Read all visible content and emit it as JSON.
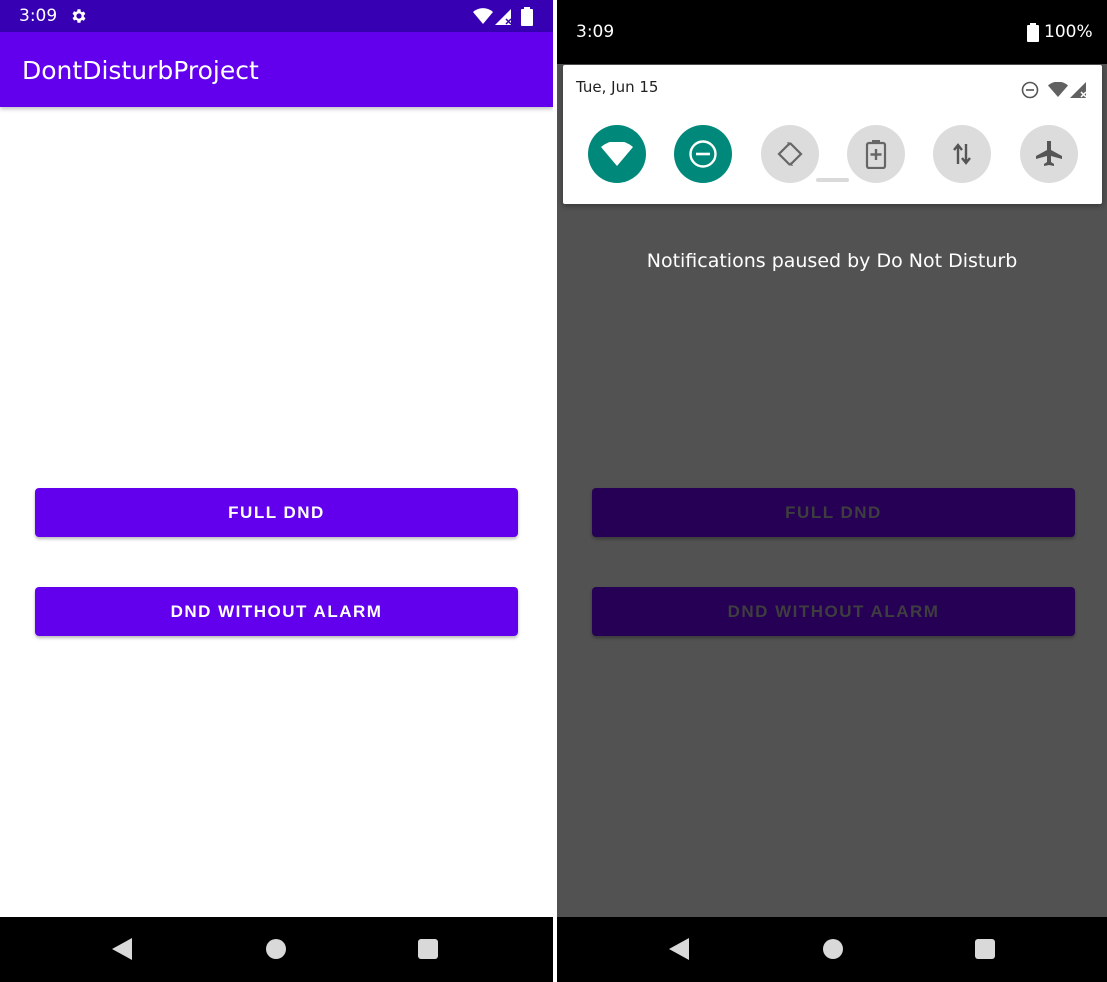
{
  "left": {
    "status_bar": {
      "time": "3:09"
    },
    "app_bar": {
      "title": "DontDisturbProject"
    },
    "buttons": {
      "full_dnd": "FULL DND",
      "dnd_without_alarm": "DND WITHOUT ALARM"
    }
  },
  "right": {
    "status_bar": {
      "time": "3:09",
      "battery_percent": "100%"
    },
    "quick_settings": {
      "date": "Tue, Jun 15",
      "tiles": [
        {
          "icon": "wifi-icon",
          "active": true
        },
        {
          "icon": "dnd-icon",
          "active": true
        },
        {
          "icon": "auto-rotate-icon",
          "active": false
        },
        {
          "icon": "battery-saver-icon",
          "active": false
        },
        {
          "icon": "mobile-data-icon",
          "active": false
        },
        {
          "icon": "airplane-mode-icon",
          "active": false
        }
      ]
    },
    "dnd_message": "Notifications paused by Do Not Disturb",
    "buttons": {
      "full_dnd": "FULL DND",
      "dnd_without_alarm": "DND WITHOUT ALARM"
    }
  },
  "colors": {
    "status_bar": "#3700b3",
    "app_bar": "#6200ee",
    "button": "#6200ee",
    "tile_active": "#00897b",
    "tile_inactive": "#dcdcdc",
    "scrim": "#525252"
  }
}
